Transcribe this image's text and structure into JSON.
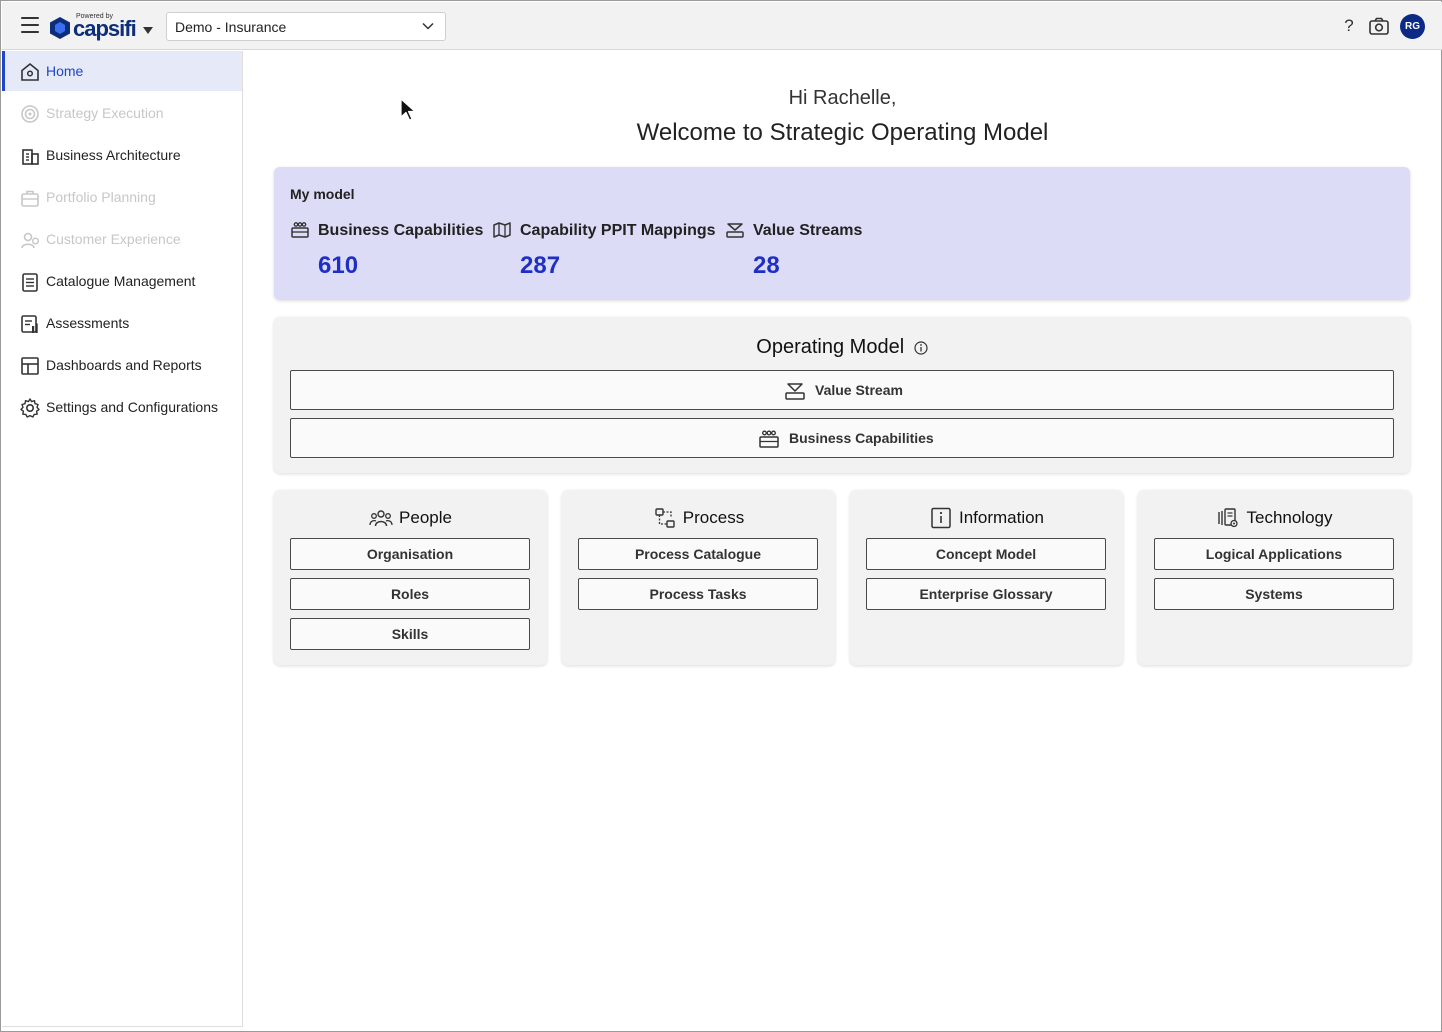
{
  "topbar": {
    "powered_by": "Powered by",
    "brand": "capsifi",
    "tenant_selected": "Demo - Insurance",
    "help_label": "?",
    "avatar_initials": "RG",
    "brand_color": "#0d2f7a"
  },
  "sidebar": {
    "items": [
      {
        "label": "Home",
        "icon": "home-icon",
        "state": "active"
      },
      {
        "label": "Strategy Execution",
        "icon": "target-icon",
        "state": "disabled"
      },
      {
        "label": "Business Architecture",
        "icon": "building-icon",
        "state": "normal"
      },
      {
        "label": "Portfolio Planning",
        "icon": "briefcase-icon",
        "state": "disabled"
      },
      {
        "label": "Customer Experience",
        "icon": "customer-icon",
        "state": "disabled"
      },
      {
        "label": "Catalogue Management",
        "icon": "catalogue-icon",
        "state": "normal"
      },
      {
        "label": "Assessments",
        "icon": "assessment-icon",
        "state": "normal"
      },
      {
        "label": "Dashboards and Reports",
        "icon": "dashboard-icon",
        "state": "normal"
      },
      {
        "label": "Settings and Configurations",
        "icon": "gear-icon",
        "state": "normal"
      }
    ]
  },
  "main": {
    "greeting": "Hi Rachelle,",
    "welcome": "Welcome to Strategic Operating Model",
    "my_model": {
      "title": "My model",
      "stats": [
        {
          "label": "Business Capabilities",
          "value": "610",
          "icon": "capabilities-icon"
        },
        {
          "label": "Capability PPIT Mappings",
          "value": "287",
          "icon": "mapping-icon"
        },
        {
          "label": "Value Streams",
          "value": "28",
          "icon": "value-stream-icon"
        }
      ],
      "accent": "#1f2fc4"
    },
    "operating_model": {
      "title": "Operating Model",
      "buttons": [
        {
          "label": "Value Stream",
          "icon": "value-stream-icon"
        },
        {
          "label": "Business Capabilities",
          "icon": "capabilities-icon"
        }
      ]
    },
    "cards": [
      {
        "title": "People",
        "icon": "people-icon",
        "buttons": [
          "Organisation",
          "Roles",
          "Skills"
        ]
      },
      {
        "title": "Process",
        "icon": "process-icon",
        "buttons": [
          "Process Catalogue",
          "Process Tasks"
        ]
      },
      {
        "title": "Information",
        "icon": "information-icon",
        "buttons": [
          "Concept Model",
          "Enterprise Glossary"
        ]
      },
      {
        "title": "Technology",
        "icon": "technology-icon",
        "buttons": [
          "Logical Applications",
          "Systems"
        ]
      }
    ]
  }
}
